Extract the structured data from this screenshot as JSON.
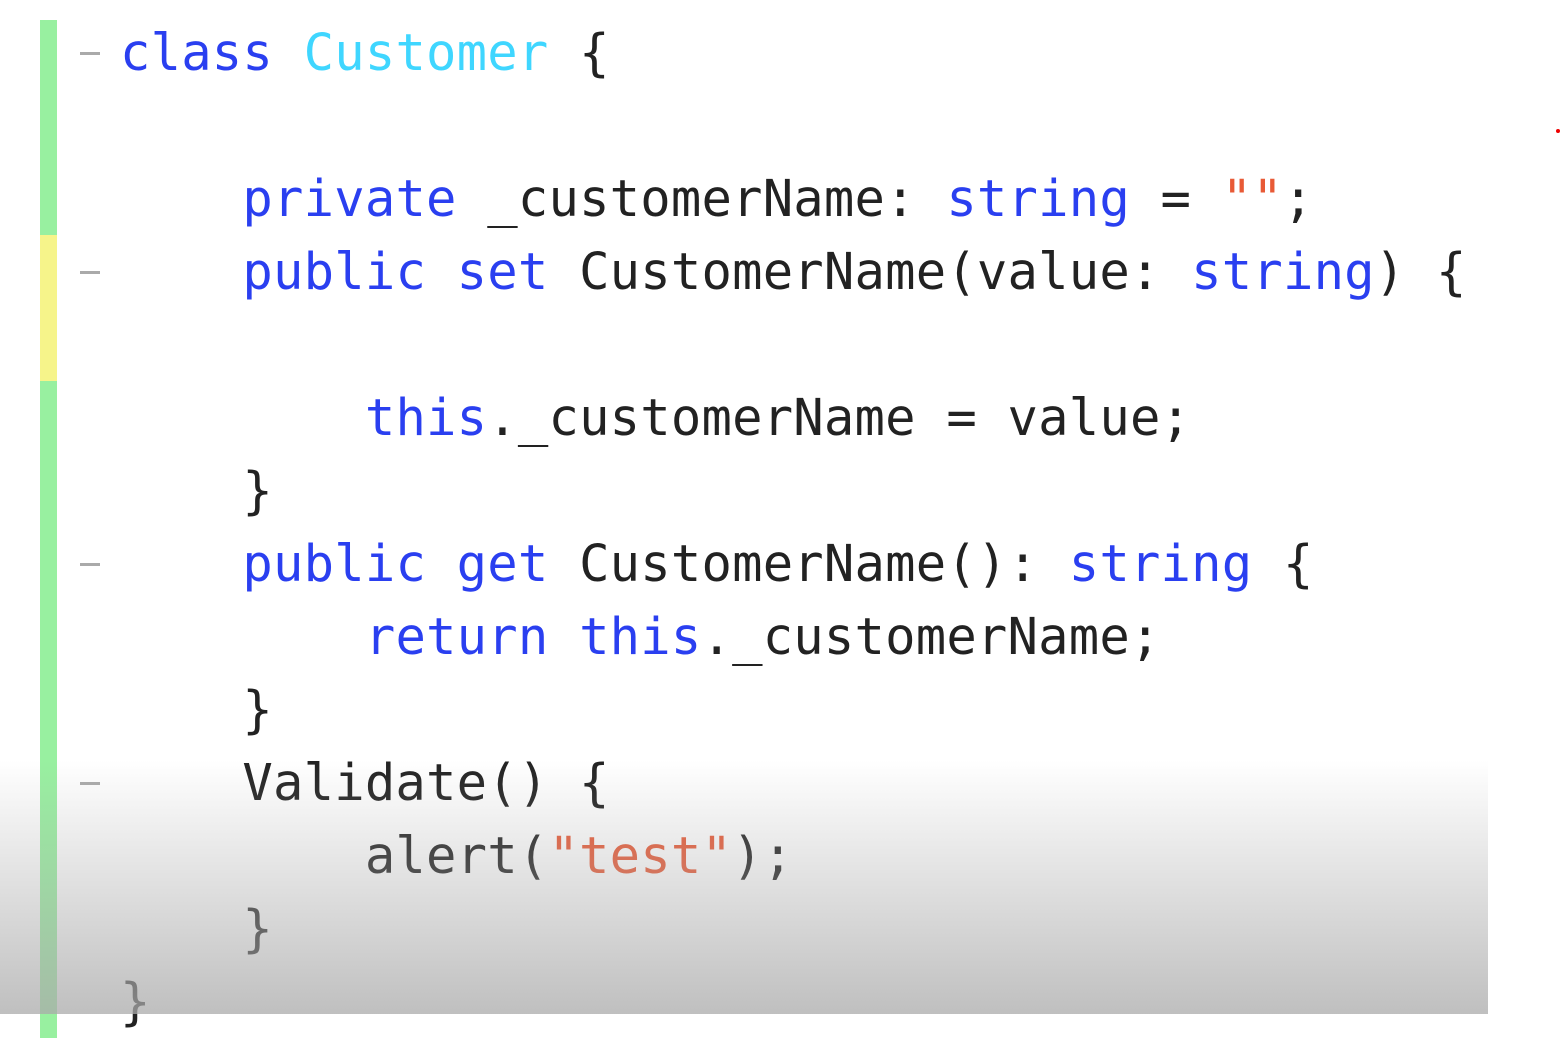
{
  "editor": {
    "colors": {
      "keyword": "#2a3ff0",
      "type": "#3fd6ff",
      "string": "#e85a36",
      "text": "#222222",
      "gutter_saved": "#98f0a0",
      "gutter_modified": "#f6f48a"
    },
    "lines": [
      [
        {
          "t": "class",
          "c": "kw"
        },
        {
          "t": " "
        },
        {
          "t": "Customer",
          "c": "ty"
        },
        {
          "t": " {"
        }
      ],
      [],
      [
        {
          "t": "    "
        },
        {
          "t": "private",
          "c": "kw"
        },
        {
          "t": " _customerName: "
        },
        {
          "t": "string",
          "c": "kw"
        },
        {
          "t": " = "
        },
        {
          "t": "\"\"",
          "c": "str"
        },
        {
          "t": ";"
        }
      ],
      [
        {
          "t": "    "
        },
        {
          "t": "public",
          "c": "kw"
        },
        {
          "t": " "
        },
        {
          "t": "set",
          "c": "kw"
        },
        {
          "t": " CustomerName(value: "
        },
        {
          "t": "string",
          "c": "kw"
        },
        {
          "t": ") {"
        }
      ],
      [],
      [
        {
          "t": "        "
        },
        {
          "t": "this",
          "c": "kw"
        },
        {
          "t": "._customerName = value;"
        }
      ],
      [
        {
          "t": "    }"
        }
      ],
      [
        {
          "t": "    "
        },
        {
          "t": "public",
          "c": "kw"
        },
        {
          "t": " "
        },
        {
          "t": "get",
          "c": "kw"
        },
        {
          "t": " CustomerName(): "
        },
        {
          "t": "string",
          "c": "kw"
        },
        {
          "t": " {"
        }
      ],
      [
        {
          "t": "        "
        },
        {
          "t": "return",
          "c": "kw"
        },
        {
          "t": " "
        },
        {
          "t": "this",
          "c": "kw"
        },
        {
          "t": "._customerName;"
        }
      ],
      [
        {
          "t": "    }"
        }
      ],
      [
        {
          "t": "    Validate() {"
        }
      ],
      [
        {
          "t": "        alert("
        },
        {
          "t": "\"test\"",
          "c": "str"
        },
        {
          "t": ");"
        }
      ],
      [
        {
          "t": "    }"
        }
      ],
      [
        {
          "t": "}"
        }
      ]
    ],
    "fold_lines": [
      0,
      3,
      7,
      10
    ],
    "modified_lines": [
      3,
      4
    ]
  }
}
